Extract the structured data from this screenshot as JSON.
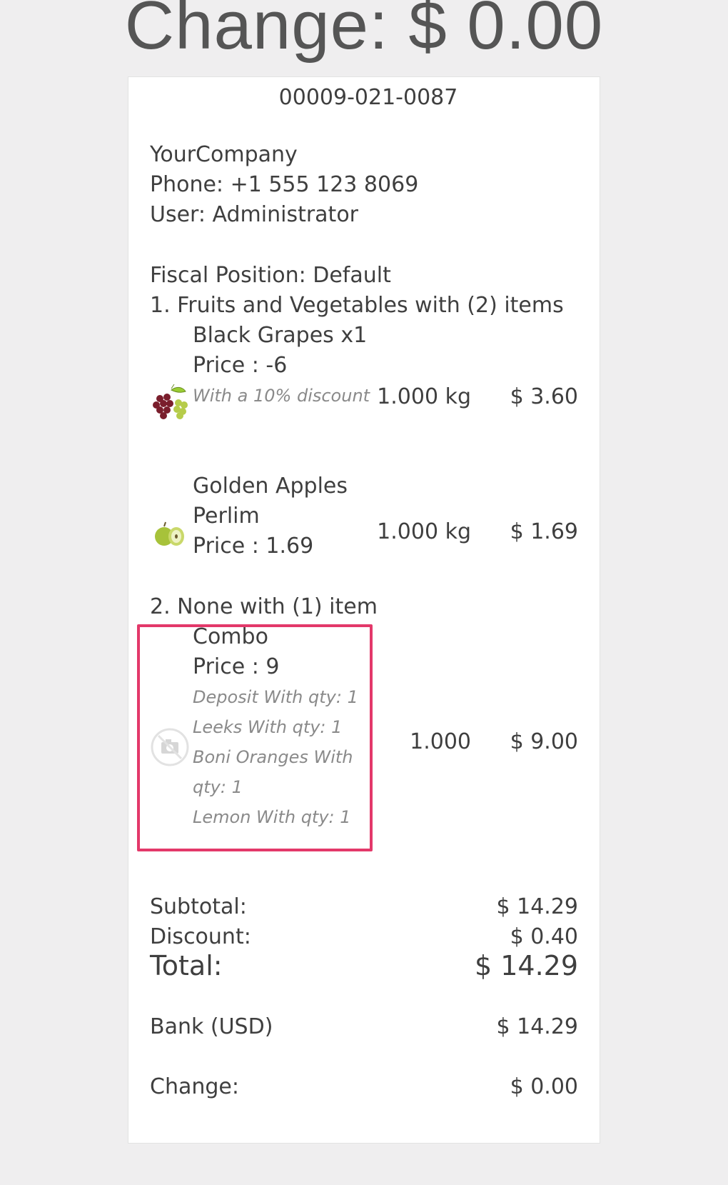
{
  "header": {
    "change_text": "Change: $ 0.00"
  },
  "receipt": {
    "order_id": "00009-021-0087",
    "company": "YourCompany",
    "phone": "Phone: +1 555 123 8069",
    "user": "User: Administrator",
    "fiscal_position": "Fiscal Position: Default",
    "groups": [
      {
        "title": "1. Fruits and Vegetables with (2) items",
        "items": [
          {
            "name": "Black Grapes x1",
            "price_line": "Price : -6",
            "note": "With a 10% discount",
            "qty": "1.000 kg",
            "total": "$ 3.60",
            "icon": "grapes-icon"
          },
          {
            "name_line1": "Golden Apples",
            "name_line2": "Perlim",
            "price_line": "Price : 1.69",
            "qty": "1.000 kg",
            "total": "$ 1.69",
            "icon": "apple-icon"
          }
        ]
      },
      {
        "title": "2. None with (1) item",
        "items": [
          {
            "name": "Combo",
            "price_line": "Price : 9",
            "components": [
              "Deposit With qty: 1",
              "Leeks With qty: 1",
              "Boni Oranges With",
              "qty: 1",
              "Lemon With qty: 1"
            ],
            "qty": "1.000",
            "total": "$ 9.00",
            "icon": "no-image-camera-icon"
          }
        ]
      }
    ],
    "totals": {
      "subtotal_label": "Subtotal:",
      "subtotal_value": "$ 14.29",
      "discount_label": "Discount:",
      "discount_value": "$ 0.40",
      "total_label": "Total:",
      "total_value": "$ 14.29"
    },
    "payment": {
      "method": "Bank (USD)",
      "amount": "$ 14.29"
    },
    "change": {
      "label": "Change:",
      "value": "$ 0.00"
    }
  },
  "colors": {
    "highlight": "#e3386a",
    "background": "#efeeef",
    "paper": "#ffffff"
  }
}
